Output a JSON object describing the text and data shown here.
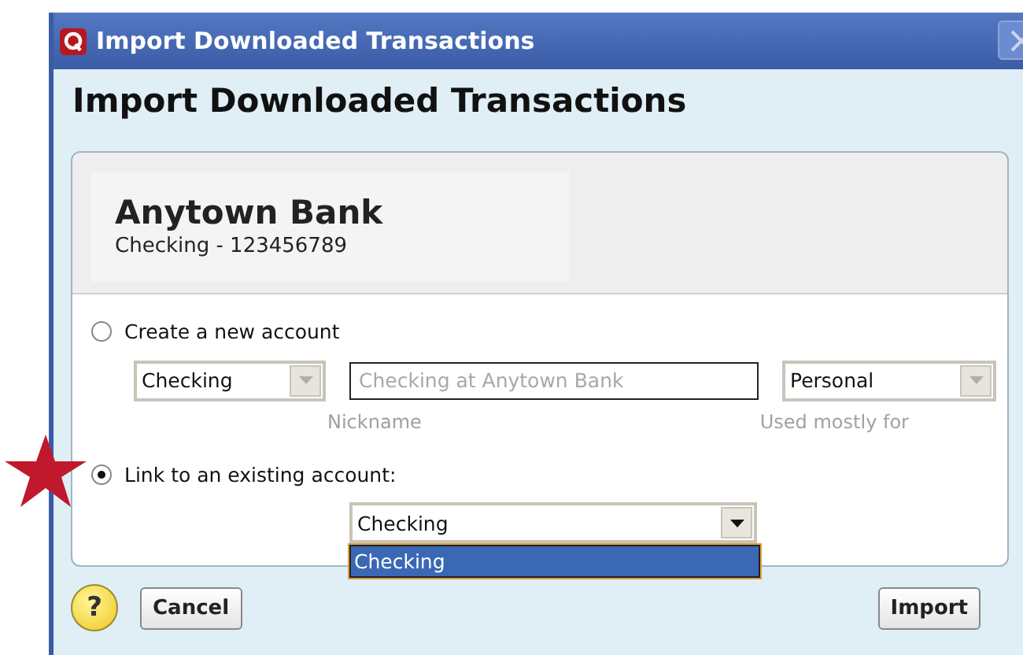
{
  "window": {
    "title": "Import Downloaded Transactions"
  },
  "heading": "Import Downloaded Transactions",
  "bank": {
    "name": "Anytown Bank",
    "account": "Checking - 123456789"
  },
  "options": [
    {
      "label": "Create a new account",
      "selected": false
    },
    {
      "label": "Link to an existing account:",
      "selected": true
    }
  ],
  "new_account": {
    "type": {
      "value": "Checking",
      "disabled": true
    },
    "nickname": {
      "placeholder": "Checking at Anytown Bank",
      "caption": "Nickname"
    },
    "usage": {
      "value": "Personal",
      "disabled": true,
      "caption": "Used mostly for"
    }
  },
  "existing_account": {
    "value": "Checking",
    "expanded": true,
    "items": [
      {
        "label": "Checking",
        "selected": true
      }
    ]
  },
  "help": "?",
  "buttons": {
    "cancel": "Cancel",
    "import": "Import"
  }
}
